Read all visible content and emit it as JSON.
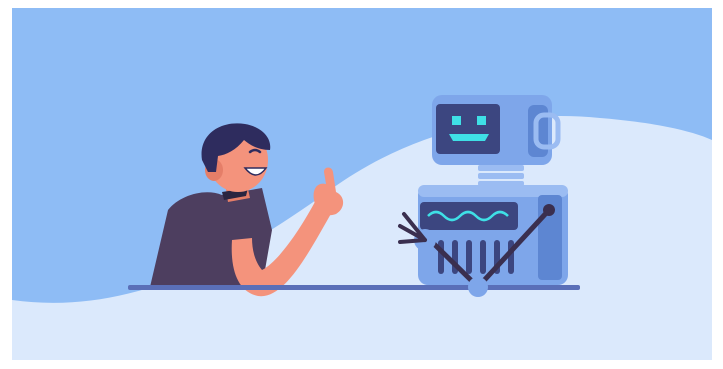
{
  "scene": {
    "description_label": "",
    "colors": {
      "frame_bg": "#ffffff",
      "sky": "#8ebcf5",
      "hill": "#dbe9fc",
      "table": "#5a6fb8",
      "robot_body": "#7ea6ea",
      "robot_shade": "#5d86d2",
      "robot_screen": "#3c4680",
      "robot_glow": "#3fe0e6",
      "robot_arm": "#3a2f4f",
      "skin": "#f4937c",
      "hair": "#2e2c5e",
      "shirt": "#4d3e5f"
    },
    "icons": {
      "person": "person-figure-icon",
      "robot": "robot-figure-icon"
    }
  }
}
